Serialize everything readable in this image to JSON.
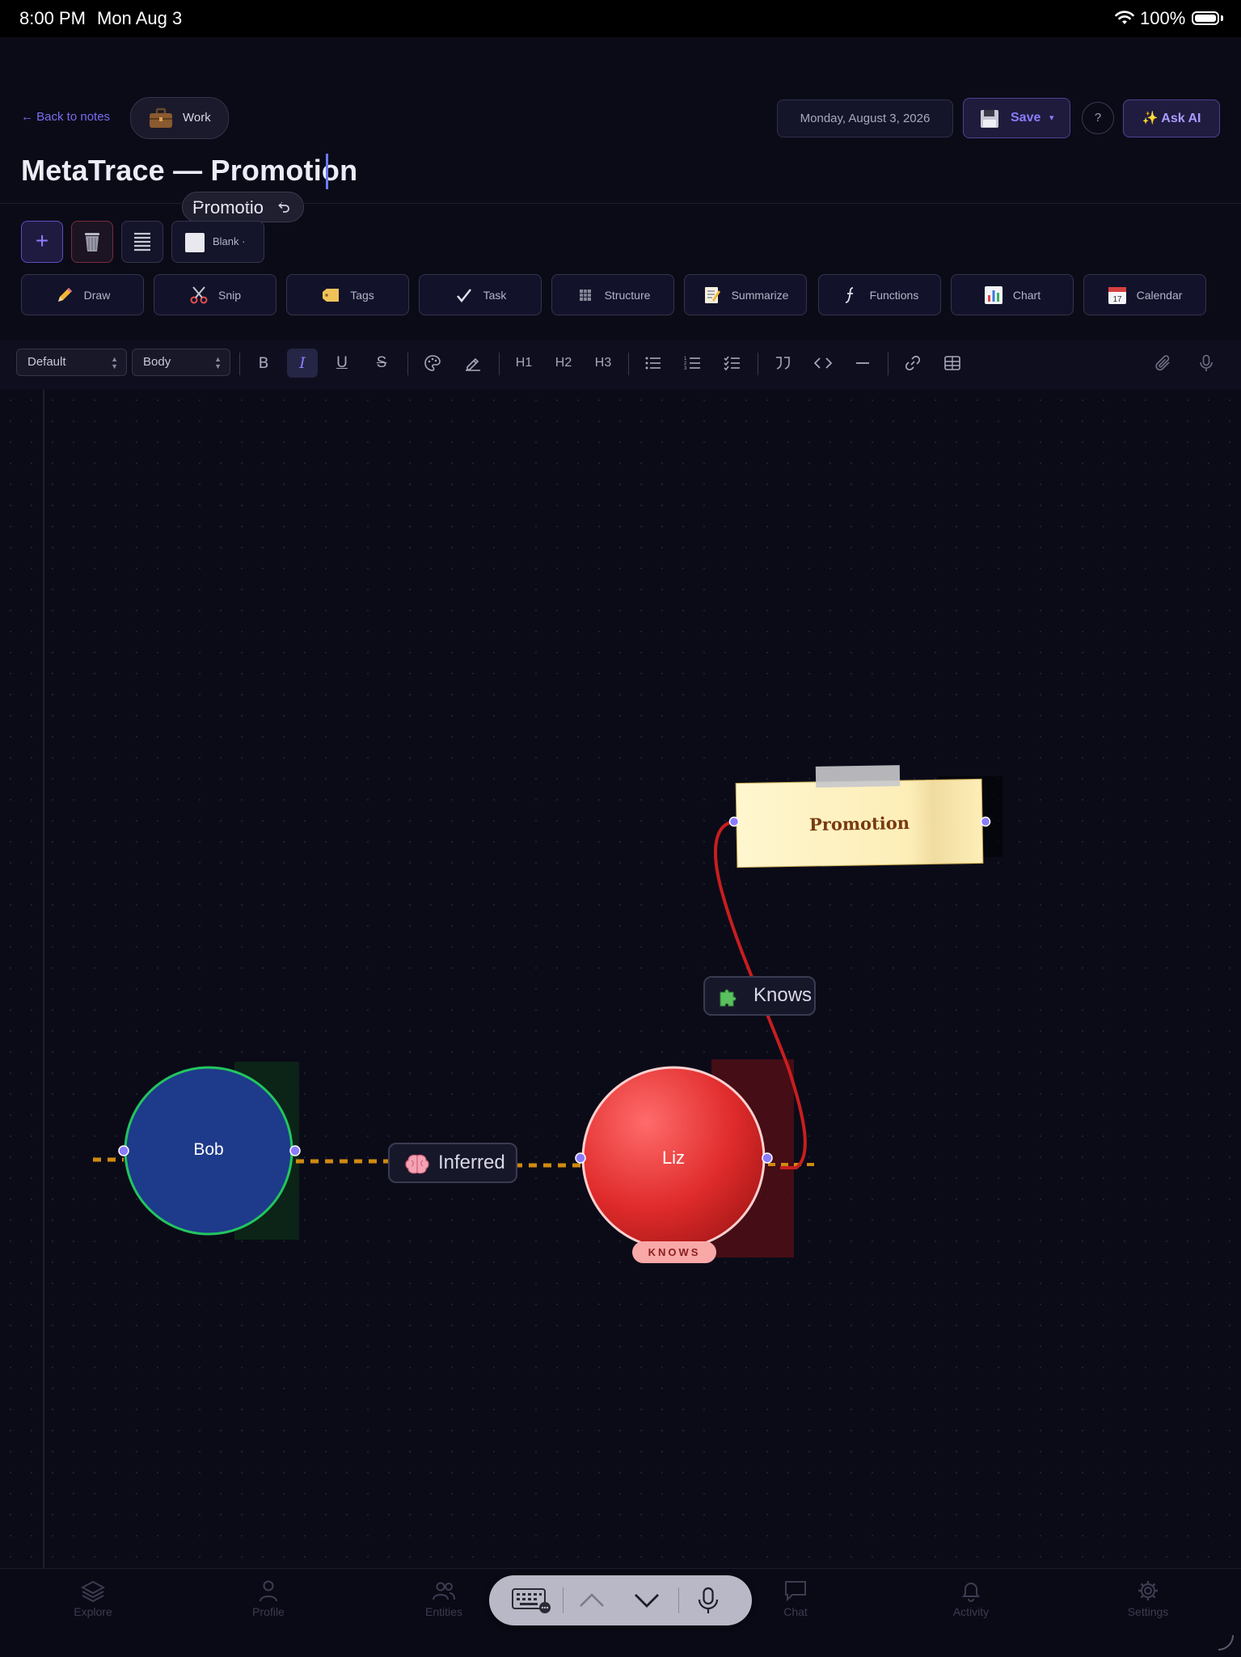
{
  "status_bar": {
    "time": "8:00 PM",
    "date": "Mon Aug 3",
    "battery": "100%"
  },
  "header": {
    "back_label": "← Back to notes",
    "notebook": "Work",
    "date": "Monday, August 3, 2026",
    "save_label": "Save",
    "help_label": "?",
    "ask_ai_label": "✨ Ask AI",
    "title": "MetaTrace — Promotion",
    "autocomplete": "Promotio"
  },
  "toolbar": {
    "add_label": "+",
    "template_label": "Blank",
    "tools": [
      {
        "label": "Draw",
        "icon": "pencil-icon"
      },
      {
        "label": "Snip",
        "icon": "scissors-icon"
      },
      {
        "label": "Tags",
        "icon": "tag-icon"
      },
      {
        "label": "Task",
        "icon": "check-icon"
      },
      {
        "label": "Structure",
        "icon": "grid-icon"
      },
      {
        "label": "Summarize",
        "icon": "memo-icon"
      },
      {
        "label": "Functions",
        "icon": "function-icon"
      },
      {
        "label": "Chart",
        "icon": "bar-chart-icon"
      },
      {
        "label": "Calendar",
        "icon": "calendar-icon"
      }
    ]
  },
  "format_bar": {
    "font": "Default",
    "style": "Body",
    "h1": "H1",
    "h2": "H2",
    "h3": "H3"
  },
  "graph": {
    "nodes": {
      "bob": {
        "label": "Bob",
        "color": "#1e3a8a",
        "ring": "#22c55e"
      },
      "liz": {
        "label": "Liz",
        "color": "#e02b2b",
        "badge": "KNOWS"
      },
      "promotion": {
        "label": "Promotion",
        "color": "#fff4c8"
      }
    },
    "edges": {
      "inferred": {
        "label": "Inferred",
        "icon": "brain-icon",
        "style": "dashed",
        "color": "#d08a10"
      },
      "knows": {
        "label": "Knows",
        "icon": "puzzle-icon",
        "style": "solid",
        "color": "#c81e1e"
      }
    }
  },
  "tab_bar": {
    "tabs": [
      {
        "label": "Explore",
        "icon": "layers-icon"
      },
      {
        "label": "Profile",
        "icon": "person-icon"
      },
      {
        "label": "Entities",
        "icon": "people-icon"
      },
      {
        "label": "Chat",
        "icon": "chat-icon"
      },
      {
        "label": "Activity",
        "icon": "bell-icon"
      },
      {
        "label": "Settings",
        "icon": "gear-icon"
      }
    ]
  }
}
